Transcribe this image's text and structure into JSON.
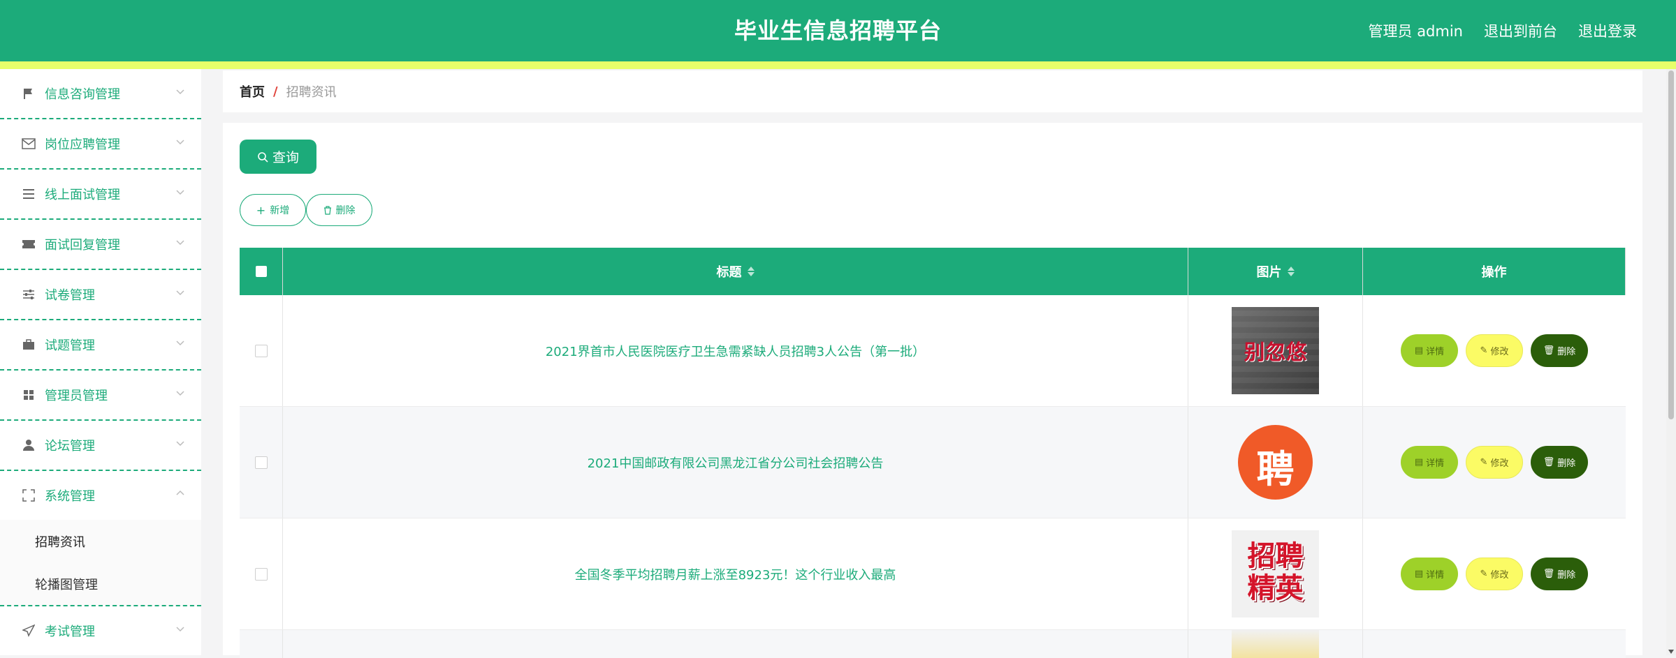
{
  "header": {
    "app_title": "毕业生信息招聘平台",
    "user_label": "管理员 admin",
    "to_front": "退出到前台",
    "logout": "退出登录"
  },
  "sidebar": {
    "items": [
      {
        "label": "信息咨询管理",
        "icon": "flag-icon"
      },
      {
        "label": "岗位应聘管理",
        "icon": "mail-icon"
      },
      {
        "label": "线上面试管理",
        "icon": "list-icon"
      },
      {
        "label": "面试回复管理",
        "icon": "ticket-icon"
      },
      {
        "label": "试卷管理",
        "icon": "sliders-icon"
      },
      {
        "label": "试题管理",
        "icon": "briefcase-icon"
      },
      {
        "label": "管理员管理",
        "icon": "grid-icon"
      },
      {
        "label": "论坛管理",
        "icon": "user-icon"
      },
      {
        "label": "系统管理",
        "icon": "fullscreen-icon",
        "expanded": true,
        "children": [
          "招聘资讯",
          "轮播图管理"
        ]
      },
      {
        "label": "考试管理",
        "icon": "send-icon"
      }
    ]
  },
  "breadcrumb": {
    "home": "首页",
    "sep": "/",
    "current": "招聘资讯"
  },
  "toolbar": {
    "query": "查询",
    "add": "新增",
    "delete": "删除"
  },
  "table": {
    "headers": {
      "title": "标题",
      "image": "图片",
      "ops": "操作"
    },
    "rows": [
      {
        "title": "2021界首市人民医院医疗卫生急需紧缺人员招聘3人公告（第一批）",
        "image_text": "别忽悠"
      },
      {
        "title": "2021中国邮政有限公司黑龙江省分公司社会招聘公告",
        "image_text": "聘"
      },
      {
        "title": "全国冬季平均招聘月薪上涨至8923元！这个行业收入最高",
        "image_text": "招聘精英"
      }
    ],
    "op_labels": {
      "detail": "详情",
      "edit": "修改",
      "del": "删除"
    }
  },
  "colors": {
    "primary": "#1cab7a",
    "stripe": "#e7ff6a",
    "detail": "#9ed129",
    "edit": "#fbfb65",
    "del": "#2b5e0a"
  }
}
